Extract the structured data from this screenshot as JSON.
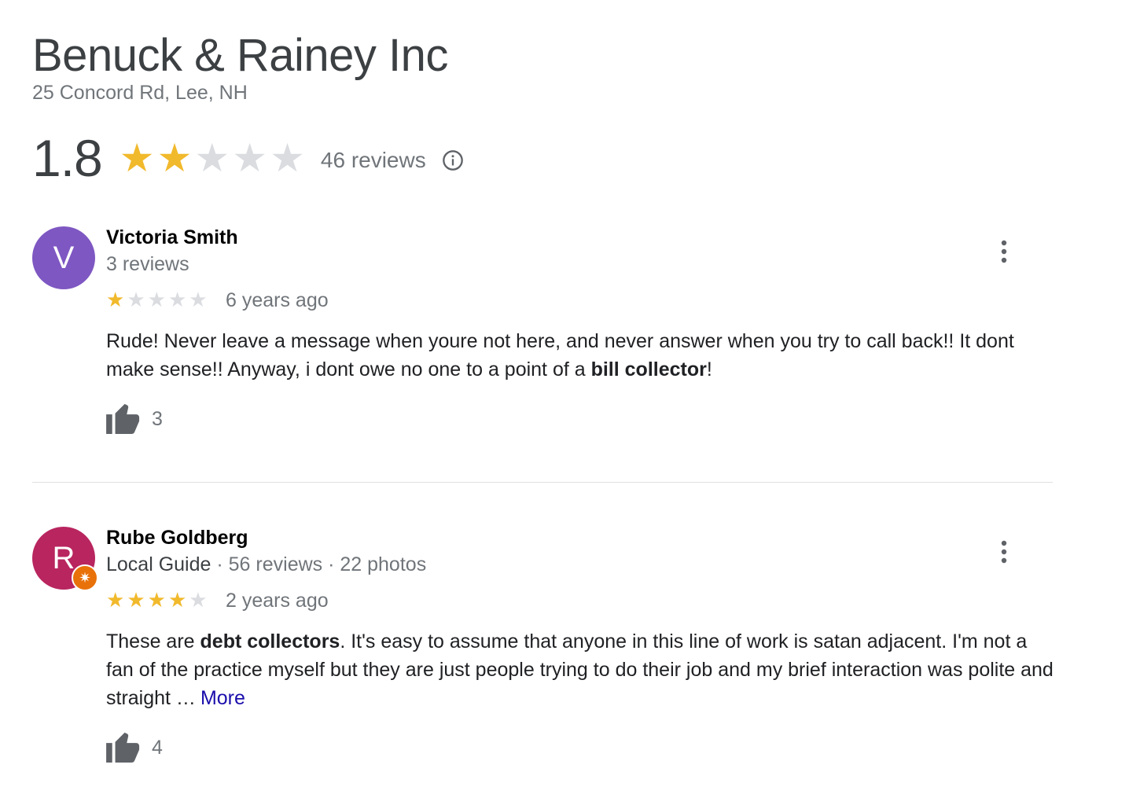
{
  "business": {
    "name": "Benuck & Rainey Inc",
    "address": "25 Concord Rd, Lee, NH",
    "rating": "1.8",
    "rating_value": 1.8,
    "review_count": "46 reviews"
  },
  "colors": {
    "star_on": "#f1b92c",
    "star_off": "#dadce0",
    "link": "#1a0dab"
  },
  "icons": {
    "info": "info-circle-icon",
    "more": "more-vert-icon",
    "like": "thumb-up-icon"
  },
  "reviews": [
    {
      "avatar_letter": "V",
      "avatar_color": "#7e57c2",
      "name": "Victoria Smith",
      "meta_reviews": "3 reviews",
      "stars": 1,
      "date": "6 years ago",
      "text_part1": "Rude! Never leave a message when youre not here, and never answer when you try to call back!! It dont make sense!!  Anyway, i dont owe no one to a point of a ",
      "text_bold": "bill collector",
      "text_part2": "!",
      "likes": "3"
    },
    {
      "avatar_letter": "R",
      "avatar_color": "#b8255f",
      "name": "Rube Goldberg",
      "meta_guide": "Local Guide",
      "meta_sep1": " · ",
      "meta_reviews": "56 reviews",
      "meta_sep2": " · ",
      "meta_photos": "22 photos",
      "stars": 4,
      "date": "2 years ago",
      "text_part1": "These are ",
      "text_bold": "debt collectors",
      "text_part2": ". It's easy to assume that anyone in this line of work  is satan adjacent. I'm not a fan of the practice myself but they are just people trying to do their job and my brief interaction was polite and straight …",
      "more_label": "More",
      "likes": "4"
    }
  ]
}
